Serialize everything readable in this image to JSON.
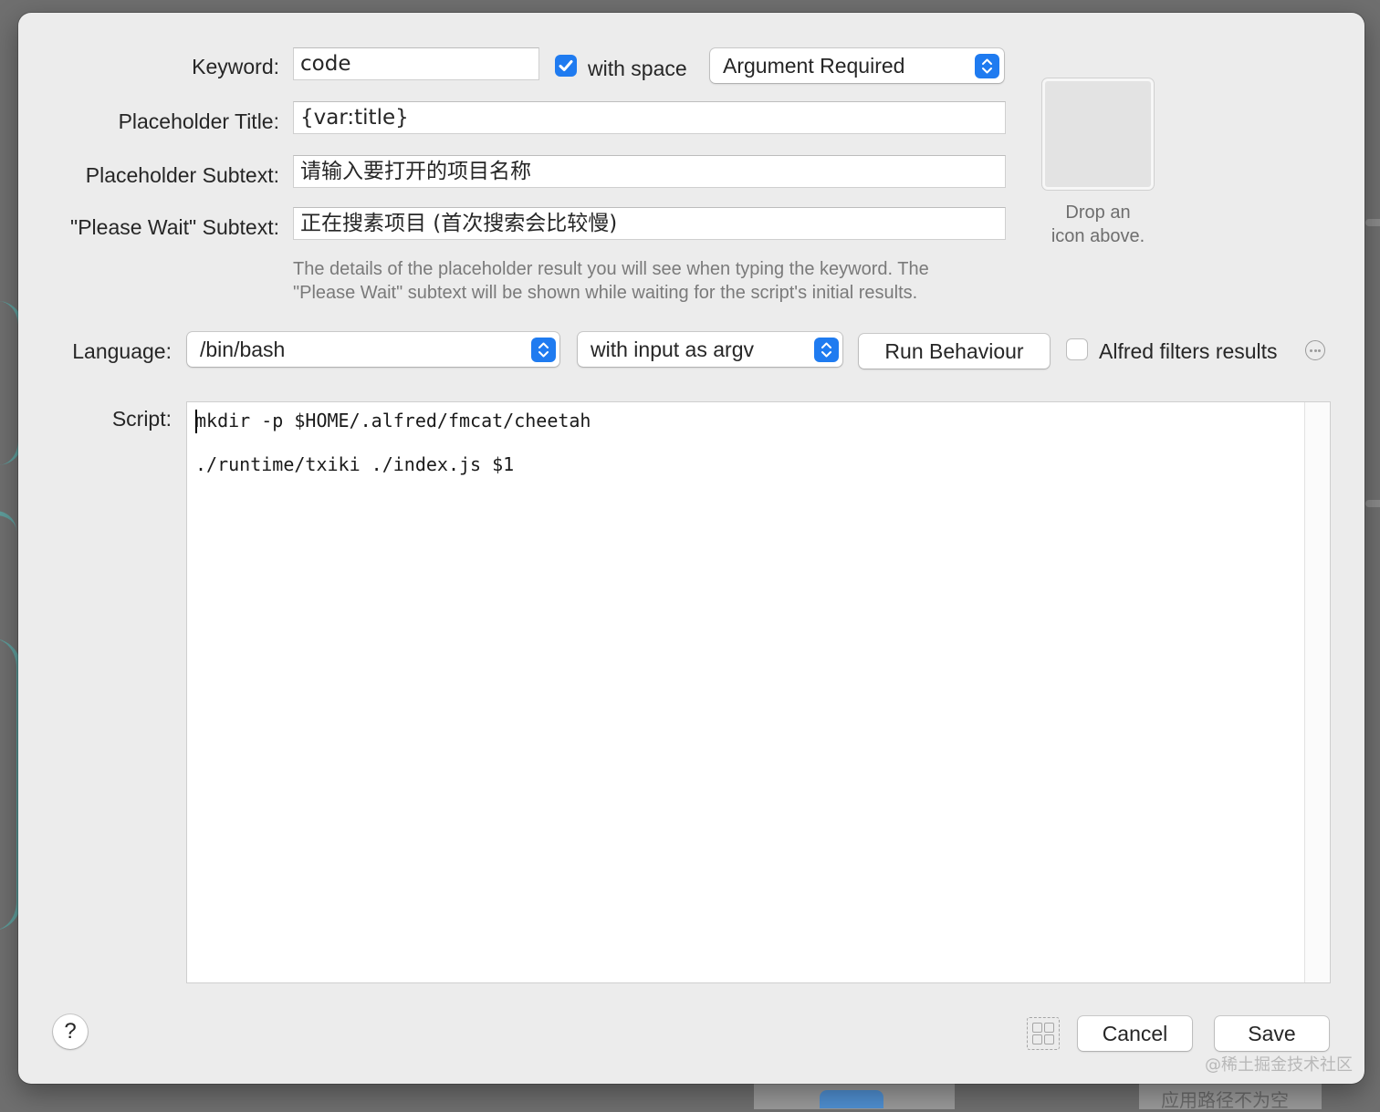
{
  "form": {
    "keyword_label": "Keyword:",
    "keyword_value": "code",
    "with_space_label": "with space",
    "with_space_checked": true,
    "argument_select": "Argument Required",
    "placeholder_title_label": "Placeholder Title:",
    "placeholder_title_value": "{var:title}",
    "placeholder_subtext_label": "Placeholder Subtext:",
    "placeholder_subtext_value": "请输入要打开的项目名称",
    "please_wait_label": "\"Please Wait\" Subtext:",
    "please_wait_value": "正在搜素项目 (首次搜索会比较慢)",
    "description_line1": "The details of the placeholder result you will see when typing the keyword. The",
    "description_line2": "\"Please Wait\" subtext will be shown while waiting for the script's initial results.",
    "icon_hint_line1": "Drop an",
    "icon_hint_line2": "icon above."
  },
  "language": {
    "label": "Language:",
    "value": "/bin/bash",
    "input_mode": "with input as argv",
    "run_behaviour_button": "Run Behaviour",
    "alfred_filters_label": "Alfred filters results",
    "alfred_filters_checked": false
  },
  "script": {
    "label": "Script:",
    "lines": [
      "mkdir -p $HOME/.alfred/fmcat/cheetah",
      "",
      "./runtime/txiki ./index.js $1"
    ]
  },
  "footer": {
    "help": "?",
    "cancel": "Cancel",
    "save": "Save"
  },
  "background": {
    "bottom_text": "应用路径不为空"
  },
  "watermark": "@稀土掘金技术社区",
  "colors": {
    "accent": "#1f7bf0",
    "dialog_bg": "#ececec",
    "backdrop": "#6f6f6f",
    "teal_line": "#5e9d9b"
  },
  "icons": [
    "checkmark-icon",
    "stepper-chevrons-icon",
    "more-options-icon",
    "layout-grid-icon",
    "help-icon"
  ]
}
